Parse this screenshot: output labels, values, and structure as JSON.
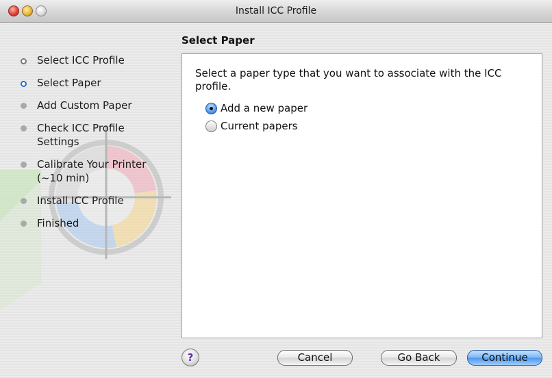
{
  "window": {
    "title": "Install ICC Profile"
  },
  "sidebar": {
    "steps": [
      {
        "label": "Select ICC Profile",
        "state": "done"
      },
      {
        "label": "Select Paper",
        "state": "current"
      },
      {
        "label": "Add Custom Paper",
        "state": "todo"
      },
      {
        "label": "Check ICC Profile Settings",
        "state": "todo"
      },
      {
        "label": "Calibrate Your Printer (~10 min)",
        "state": "todo"
      },
      {
        "label": "Install ICC Profile",
        "state": "todo"
      },
      {
        "label": "Finished",
        "state": "todo"
      }
    ]
  },
  "main": {
    "heading": "Select Paper",
    "instruction": "Select a paper type that you want to associate with the ICC profile.",
    "options": [
      {
        "label": "Add a new paper",
        "selected": true
      },
      {
        "label": "Current papers",
        "selected": false
      }
    ]
  },
  "buttons": {
    "help": "?",
    "cancel": "Cancel",
    "go_back": "Go Back",
    "continue": "Continue"
  },
  "colors": {
    "accent": "#4d96ea",
    "current_step": "#2b6bd3"
  }
}
